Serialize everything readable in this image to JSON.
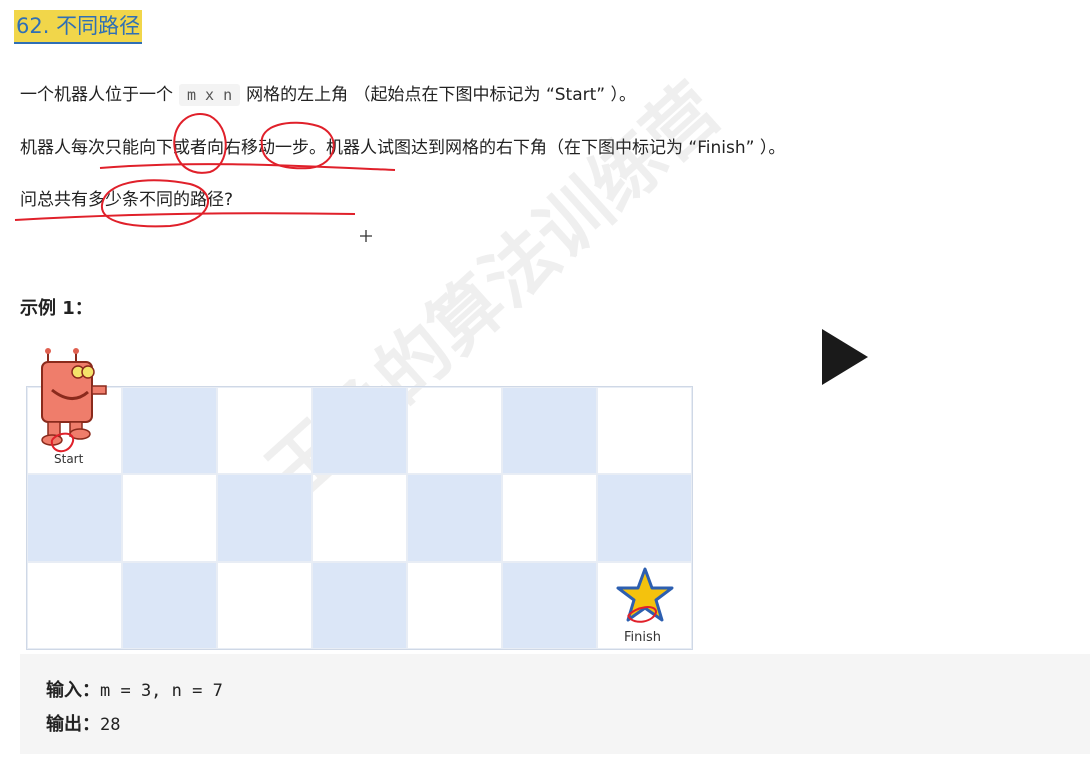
{
  "title": "62. 不同路径",
  "paragraphs": {
    "p1_before": "一个机器人位于一个",
    "p1_code": "m x n",
    "p1_after": "网格的左上角 （起始点在下图中标记为 “Start” ）。",
    "p2": "机器人每次只能向下或者向右移动一步。机器人试图达到网格的右下角（在下图中标记为 “Finish” ）。",
    "p3": "问总共有多少条不同的路径?"
  },
  "example": {
    "title": "示例 1：",
    "grid": {
      "rows": 3,
      "cols": 7
    },
    "start_label": "Start",
    "finish_label": "Finish",
    "input_label": "输入：",
    "input_value": "m = 3, n = 7",
    "output_label": "输出：",
    "output_value": "28"
  },
  "watermark": "王争的算法训练营",
  "icons": {
    "play": "play-icon",
    "robot": "robot-icon",
    "star": "star-icon"
  },
  "colors": {
    "title_highlight": "#f1d64a",
    "title_text": "#2f6fb5",
    "grid_blue": "#dbe6f7",
    "annotation_red": "#e0202a",
    "star_yellow": "#f4c20d",
    "star_border": "#2d5fb0"
  }
}
